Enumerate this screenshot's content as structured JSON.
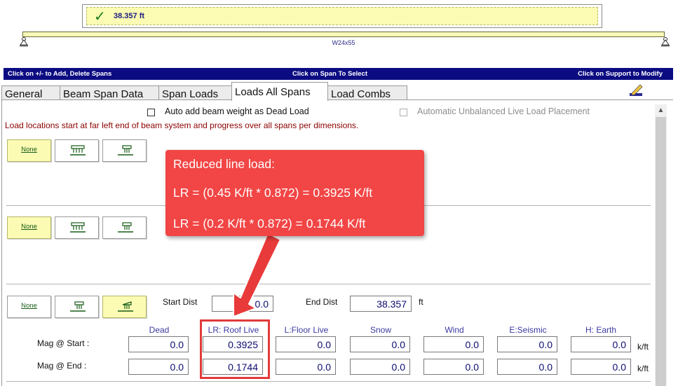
{
  "header": {
    "status_value": "38.357 ft",
    "beam_label": "W24x55"
  },
  "info_bar": {
    "left": "Click on  +/-  to Add, Delete Spans",
    "center": "Click on Span To Select",
    "right": "Click on Support to Modify"
  },
  "tabs": [
    {
      "label": "General",
      "active": false
    },
    {
      "label": "Beam Span Data",
      "active": false
    },
    {
      "label": "Span Loads",
      "active": false
    },
    {
      "label": "Loads All Spans",
      "active": true
    },
    {
      "label": "Load Combs",
      "active": false
    }
  ],
  "options": {
    "auto_beam_weight": {
      "label": "Auto add beam weight as Dead Load",
      "checked": false
    },
    "unbalanced_live": {
      "label": "Automatic Unbalanced Live Load Placement",
      "checked": false,
      "enabled": false
    }
  },
  "note": "Load locations start at far left end of beam system and progress over all spans per dimensions.",
  "load_type_buttons": {
    "none_label": "None"
  },
  "load_rows": [
    {
      "selected": "none"
    },
    {
      "selected": "none"
    },
    {
      "selected": "partial"
    }
  ],
  "distances": {
    "start_label": "Start Dist",
    "start_value": "0.0",
    "end_label": "End Dist",
    "end_value": "38.357",
    "unit": "ft"
  },
  "magnitudes": {
    "columns": [
      "Dead",
      "LR: Roof Live",
      "L:Floor Live",
      "Snow",
      "Wind",
      "E:Seismic",
      "H: Earth"
    ],
    "start_label": "Mag @ Start :",
    "end_label": "Mag @ End :",
    "start_values": [
      "0.0",
      "0.3925",
      "0.0",
      "0.0",
      "0.0",
      "0.0",
      "0.0"
    ],
    "end_values": [
      "0.0",
      "0.1744",
      "0.0",
      "0.0",
      "0.0",
      "0.0",
      "0.0"
    ],
    "unit": "k/ft"
  },
  "callout": {
    "line1": "Reduced line load:",
    "line2": "LR = (0.45 K/ft * 0.872) = 0.3925 K/ft",
    "line3": "LR = (0.2 K/ft * 0.872) = 0.1744 K/ft"
  },
  "colors": {
    "info_bar": "#0c0c82",
    "selected_button": "#fbfbb4",
    "callout": "#f24545",
    "note_text": "#8c0000",
    "field_text": "#0c0c70"
  },
  "icons": [
    "check-icon",
    "pin-support-icon",
    "uniform-load-icon",
    "partial-load-icon",
    "trapezoid-load-icon",
    "edit-pencil-icon",
    "scroll-up-icon"
  ]
}
